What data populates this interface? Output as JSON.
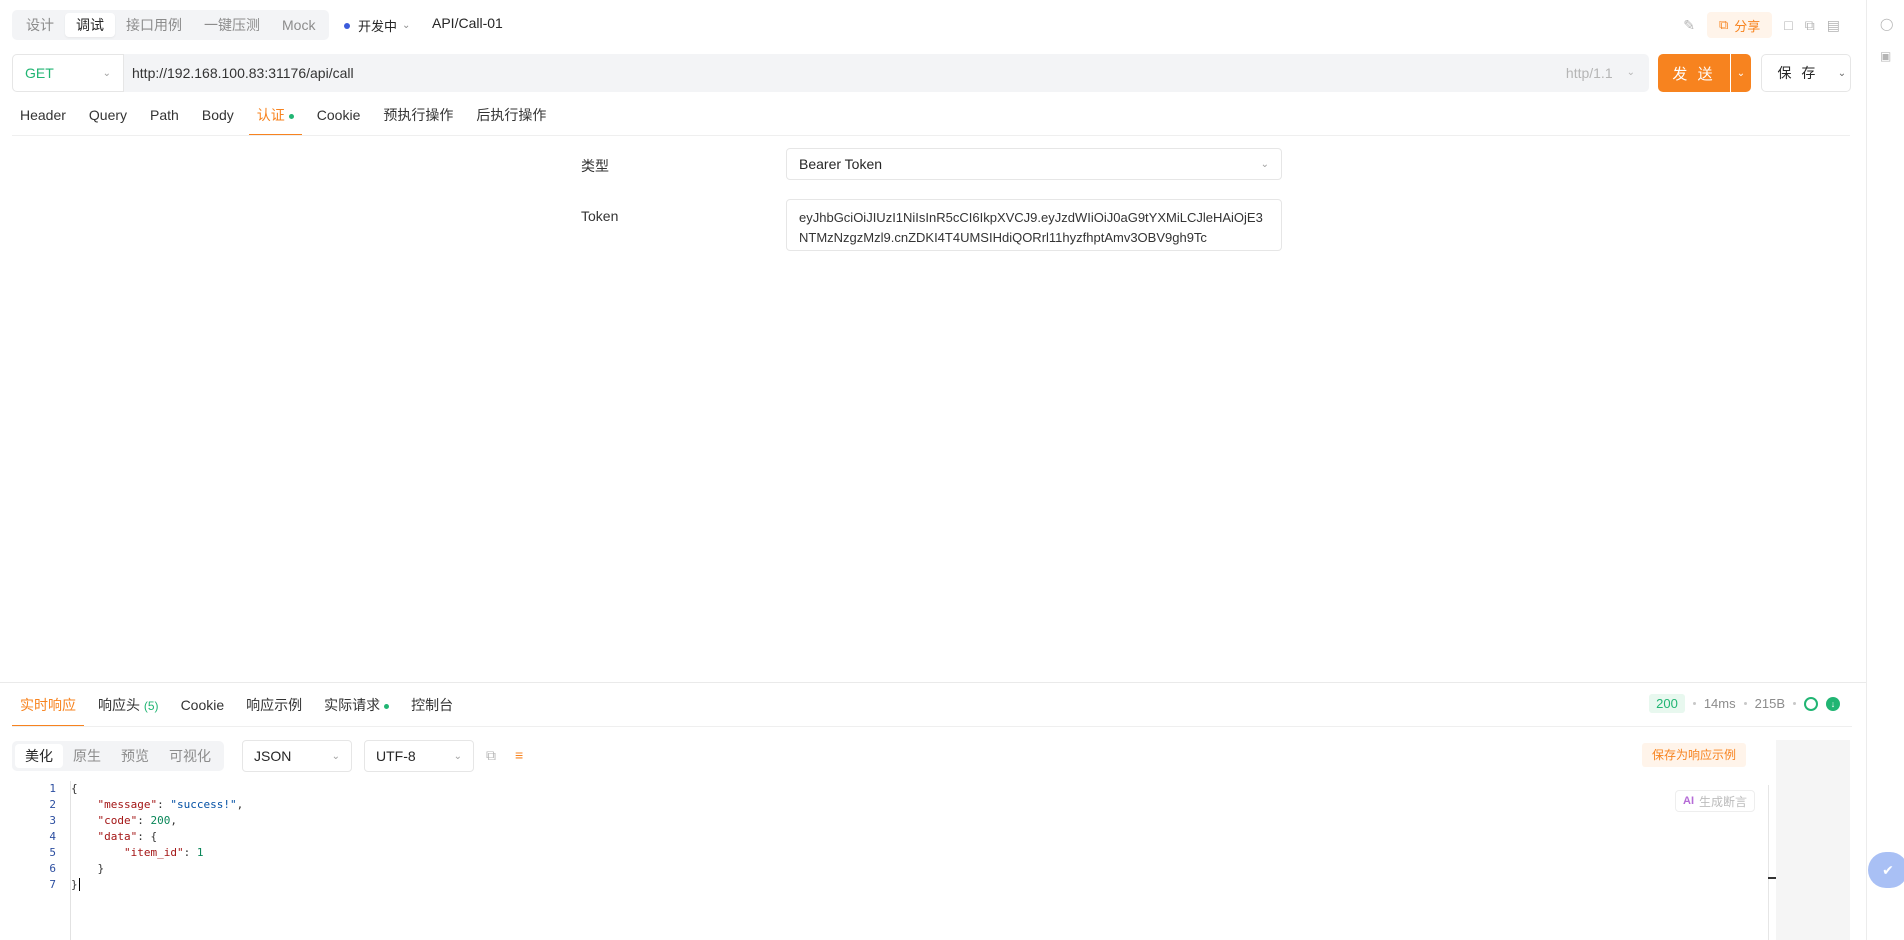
{
  "top": {
    "mode_tabs": [
      "设计",
      "调试",
      "接口用例",
      "一键压测",
      "Mock"
    ],
    "active_mode": "调试",
    "status": "开发中",
    "api_name": "API/Call-01",
    "share_label": "分享"
  },
  "request": {
    "method": "GET",
    "url": "http://192.168.100.83:31176/api/call",
    "protocol": "http/1.1",
    "send_label": "发 送",
    "save_label": "保 存",
    "tabs": [
      "Header",
      "Query",
      "Path",
      "Body",
      "认证",
      "Cookie",
      "预执行操作",
      "后执行操作"
    ],
    "active_tab": "认证"
  },
  "auth": {
    "type_label": "类型",
    "type_value": "Bearer Token",
    "token_label": "Token",
    "token_value": "eyJhbGciOiJIUzI1NiIsInR5cCI6IkpXVCJ9.eyJzdWIiOiJ0aG9tYXMiLCJleHAiOjE3NTMzNzgzMzl9.cnZDKI4T4UMSIHdiQORrl11hyzfhptAmv3OBV9gh9Tc"
  },
  "response": {
    "tabs": [
      "实时响应",
      "响应头",
      "Cookie",
      "响应示例",
      "实际请求",
      "控制台"
    ],
    "header_count": "(5)",
    "status_code": "200",
    "time": "14ms",
    "size": "215B",
    "format_tabs": [
      "美化",
      "原生",
      "预览",
      "可视化"
    ],
    "active_format": "美化",
    "content_type": "JSON",
    "encoding": "UTF-8",
    "save_example_label": "保存为响应示例",
    "ai_label": "生成断言",
    "ai_badge": "AI",
    "line_numbers": [
      "1",
      "2",
      "3",
      "4",
      "5",
      "6",
      "7"
    ],
    "json": {
      "open": "{",
      "message_key": "\"message\"",
      "message_val": "\"success!\"",
      "code_key": "\"code\"",
      "code_val": "200",
      "data_key": "\"data\"",
      "item_key": "\"item_id\"",
      "item_val": "1",
      "close_inner": "}",
      "close": "}"
    }
  },
  "icons": {
    "share": "share-icon",
    "lock": "lock-icon",
    "copy": "copy-icon",
    "delete": "delete-icon",
    "wrap": "wrap-lines-icon",
    "globe": "globe-icon",
    "download": "download-icon"
  },
  "colors": {
    "accent": "#f7831f",
    "success": "#21b573",
    "status_dot": "#3b5bdb"
  }
}
